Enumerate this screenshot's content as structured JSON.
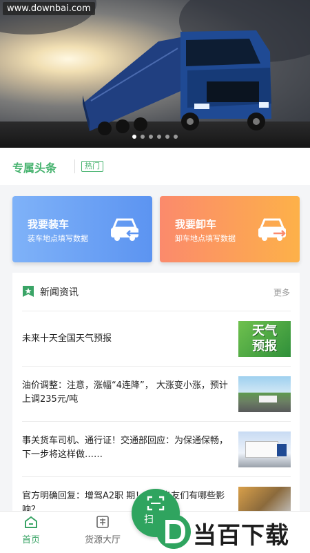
{
  "banner": {
    "watermark": "www.downbai.com",
    "slide_count": 6,
    "active_slide": 0
  },
  "headline": {
    "title": "专属头条",
    "badge": "热门"
  },
  "actions": {
    "load": {
      "title": "我要装车",
      "subtitle": "装车地点填写数据",
      "icon": "truck-load-icon"
    },
    "unload": {
      "title": "我要卸车",
      "subtitle": "卸车地点填写数据",
      "icon": "truck-unload-icon"
    }
  },
  "news": {
    "title": "新闻资讯",
    "more": "更多",
    "items": [
      {
        "text": "未来十天全国天气预报",
        "thumb_text": "天气\n预报"
      },
      {
        "text": "油价调整：注意，涨幅“4连降”， 大涨变小涨，预计上调235元/吨"
      },
      {
        "text": "事关货车司机、通行证！交通部回应：为保通保畅，下一步将这样做……"
      },
      {
        "text": "官方明确回复：增驾A2职 期！这对卡友们有哪些影响？"
      }
    ]
  },
  "tabbar": {
    "home": "首页",
    "cargo": "货源大厅",
    "scan": "扫"
  },
  "logo_watermark": "当百下载",
  "colors": {
    "brand_green": "#47b36f",
    "load_blue": "#5c94f1",
    "unload_orange": "#fdb149"
  }
}
